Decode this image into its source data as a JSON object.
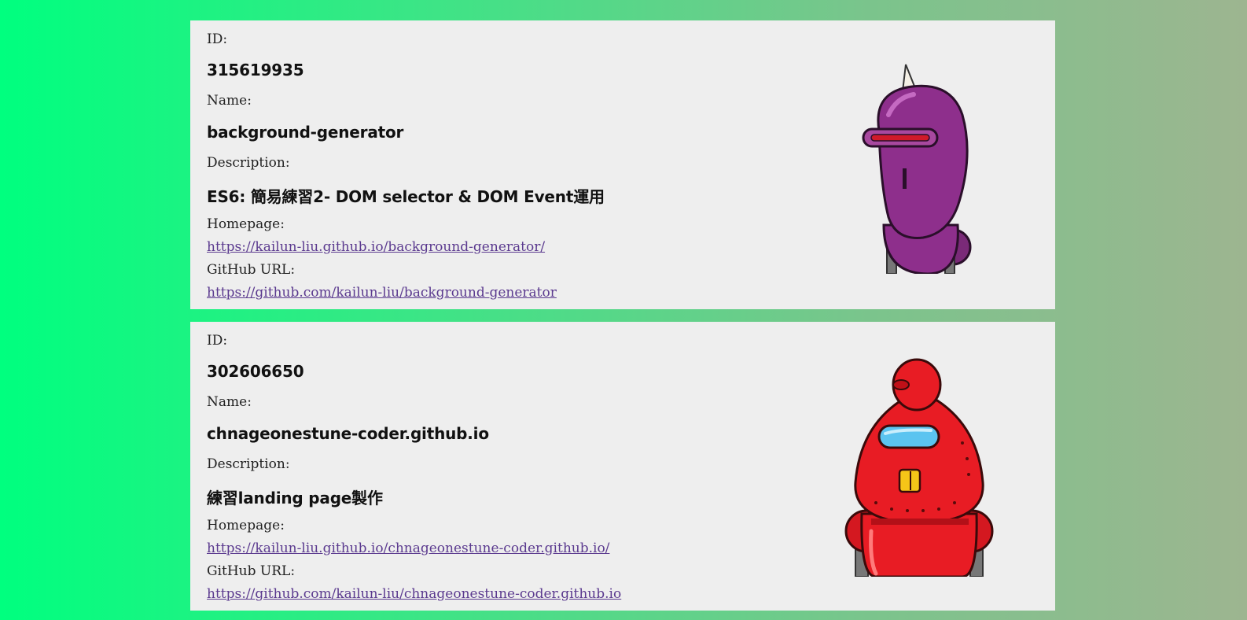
{
  "repos": [
    {
      "id_label": "ID:",
      "id": "315619935",
      "name_label": "Name:",
      "name": "background-generator",
      "description_label": "Description:",
      "description": "ES6: 簡易練習2- DOM selector & DOM Event運用",
      "homepage_label": "Homepage:",
      "homepage": "https://kailun-liu.github.io/background-generator/",
      "github_label": "GitHub URL:",
      "github": "https://github.com/kailun-liu/background-generator",
      "avatar_icon": "purple-robot-icon"
    },
    {
      "id_label": "ID:",
      "id": "302606650",
      "name_label": "Name:",
      "name": "chnageonestune-coder.github.io",
      "description_label": "Description:",
      "description": "練習landing page製作",
      "homepage_label": "Homepage:",
      "homepage": "https://kailun-liu.github.io/chnageonestune-coder.github.io/",
      "github_label": "GitHub URL:",
      "github": "https://github.com/kailun-liu/chnageonestune-coder.github.io",
      "avatar_icon": "red-robot-icon"
    }
  ],
  "colors": {
    "card_bg": "#eeeeee",
    "link": "#5b3a8f",
    "gradient_start": "#00ff7f",
    "gradient_end": "#9db590"
  }
}
